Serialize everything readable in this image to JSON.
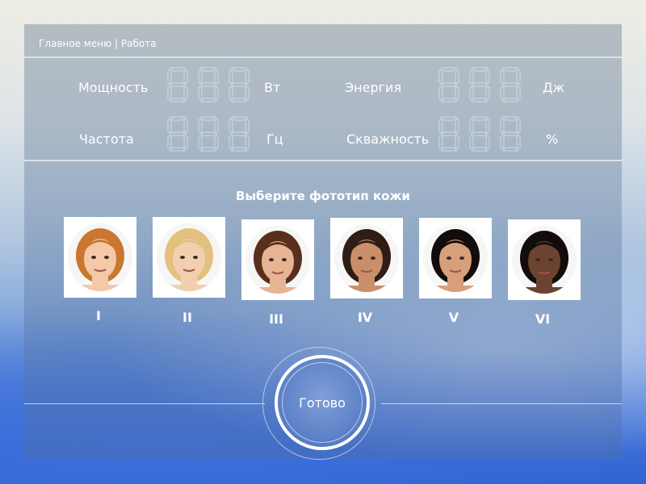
{
  "breadcrumb": {
    "main": "Главное меню",
    "separator": " | ",
    "current": "Работа"
  },
  "metrics": {
    "power": {
      "label": "Мощность",
      "unit": "Вт"
    },
    "energy": {
      "label": "Энергия",
      "unit": "Дж"
    },
    "frequency": {
      "label": "Частота",
      "unit": "Гц"
    },
    "duty": {
      "label": "Скважность",
      "unit": "%"
    }
  },
  "skin_section": {
    "heading": "Выберите фототип кожи",
    "types": [
      {
        "label": "I",
        "skin": "#f3c9a8",
        "hair": "#c9772f"
      },
      {
        "label": "II",
        "skin": "#f2cfae",
        "hair": "#e2c07d"
      },
      {
        "label": "III",
        "skin": "#e6b493",
        "hair": "#5a2e1c"
      },
      {
        "label": "IV",
        "skin": "#c98f6a",
        "hair": "#2f1c14"
      },
      {
        "label": "V",
        "skin": "#d6a07a",
        "hair": "#120c0a"
      },
      {
        "label": "VI",
        "skin": "#6b4330",
        "hair": "#120d0b"
      }
    ]
  },
  "done_button": {
    "label": "Готово"
  }
}
